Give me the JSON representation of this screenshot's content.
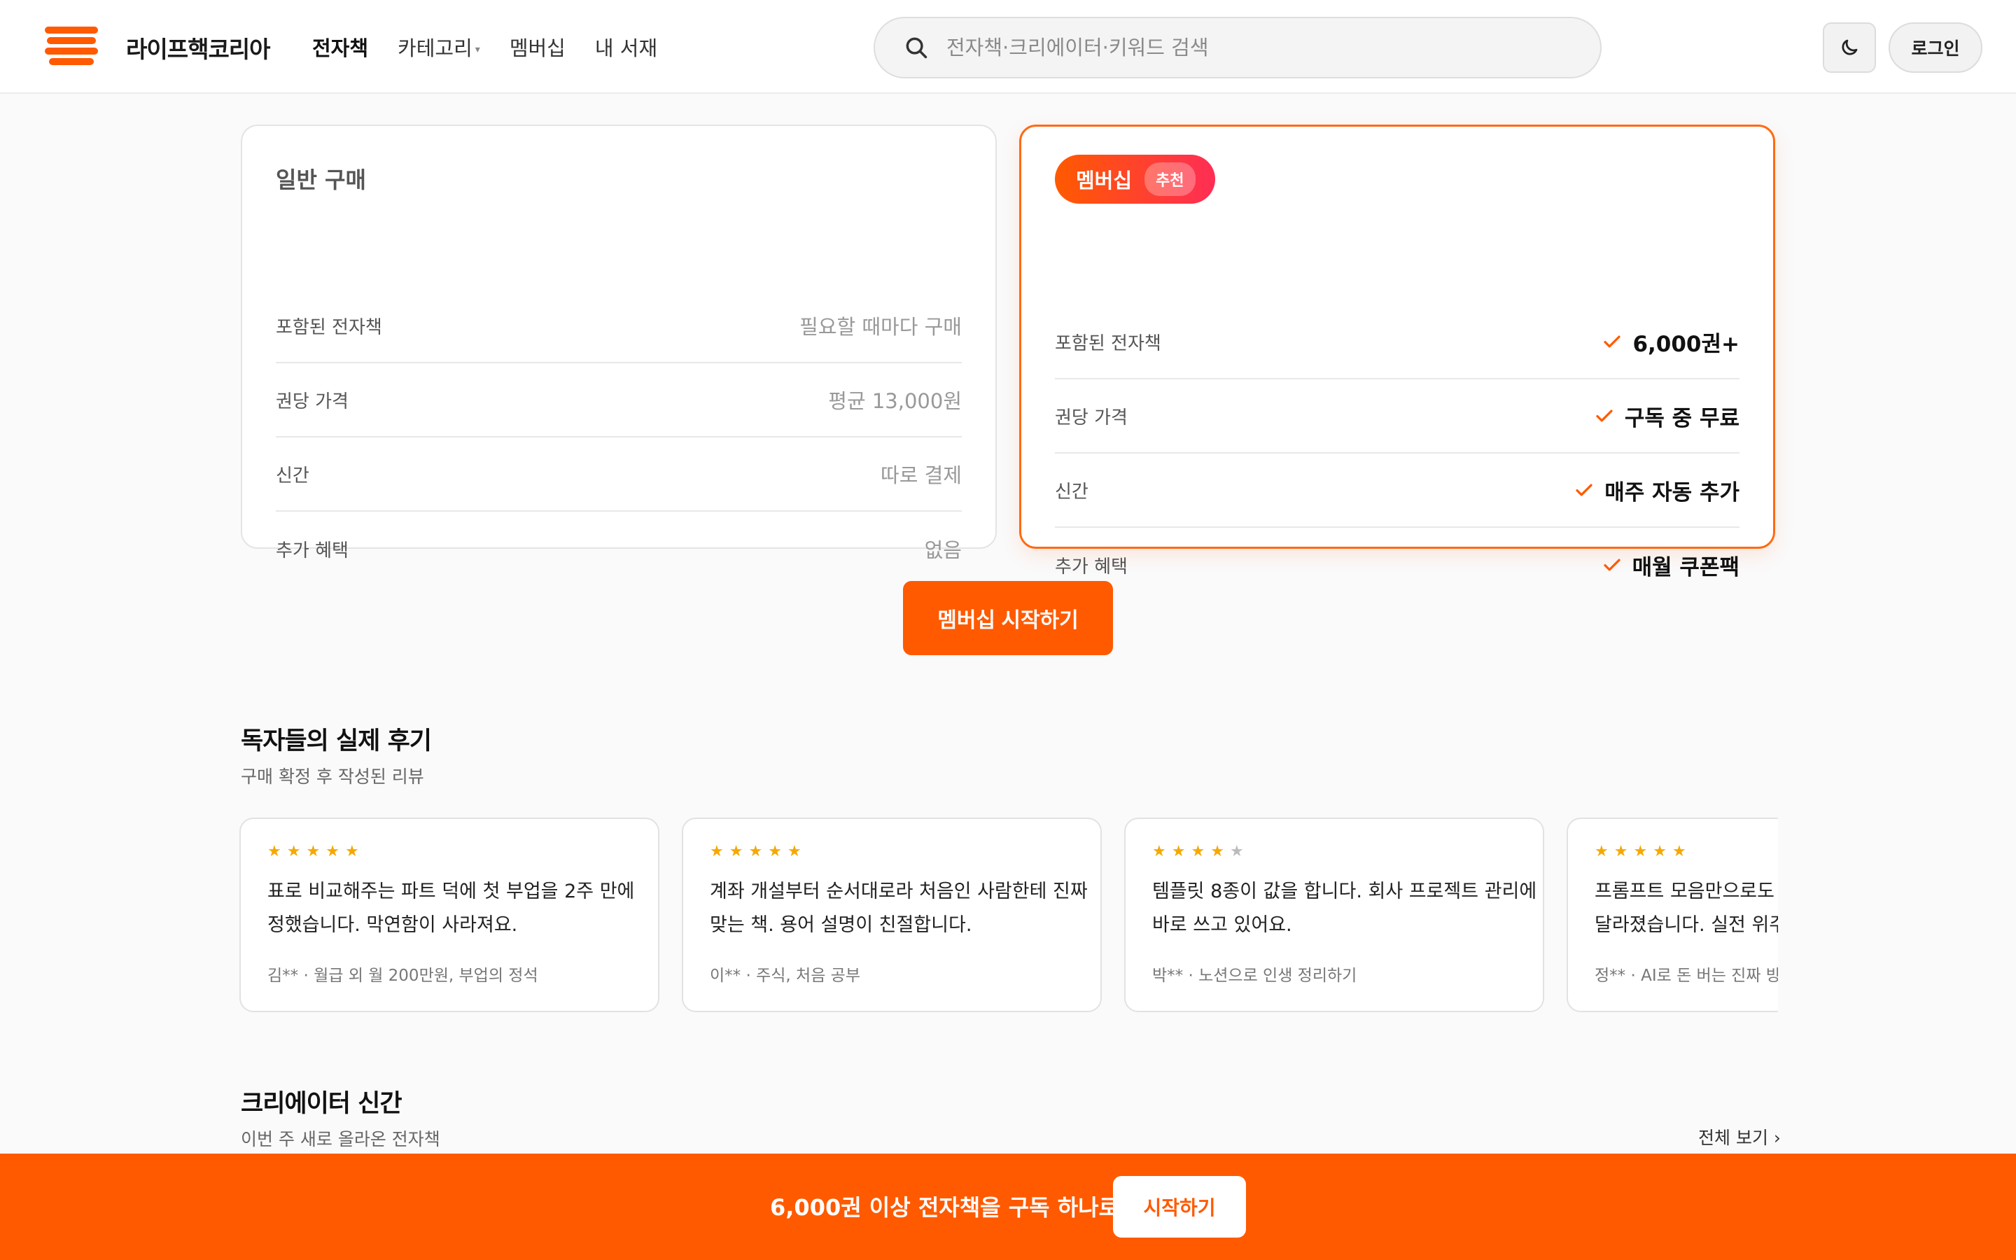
{
  "header": {
    "brand": "라이프핵코리아",
    "nav": [
      {
        "label": "전자책"
      },
      {
        "label": "카테고리"
      },
      {
        "label": "멤버십"
      },
      {
        "label": "내 서재"
      }
    ],
    "search_placeholder": "전자책·크리에이터·키워드 검색",
    "login_label": "로그인"
  },
  "pricing": {
    "basic": {
      "title": "일반 구매",
      "rows": [
        {
          "key": "포함된 전자책",
          "value": "필요할 때마다 구매"
        },
        {
          "key": "권당 가격",
          "value": "평균 13,000원"
        },
        {
          "key": "신간",
          "value": "따로 결제"
        },
        {
          "key": "추가 혜택",
          "value": "없음"
        }
      ]
    },
    "member": {
      "title": "멤버십",
      "tag": "추천",
      "rows": [
        {
          "key": "포함된 전자책",
          "value": "6,000권+"
        },
        {
          "key": "권당 가격",
          "value": "구독 중 무료"
        },
        {
          "key": "신간",
          "value": "매주 자동 추가"
        },
        {
          "key": "추가 혜택",
          "value": "매월 쿠폰팩"
        }
      ]
    },
    "cta_label": "멤버십 시작하기"
  },
  "reviews": {
    "title": "독자들의 실제 후기",
    "subtitle": "구매 확정 후 작성된 리뷰",
    "items": [
      {
        "rating": 5,
        "line1": "표로 비교해주는 파트 덕에 첫 부업을 2주 만에",
        "line2": "정했습니다. 막연함이 사라져요.",
        "meta": "김** · 월급 외 월 200만원, 부업의 정석"
      },
      {
        "rating": 5,
        "line1": "계좌 개설부터 순서대로라 처음인 사람한테 진짜",
        "line2": "맞는 책. 용어 설명이 친절합니다.",
        "meta": "이** · 주식, 처음 공부"
      },
      {
        "rating": 4,
        "line1": "템플릿 8종이 값을 합니다. 회사 프로젝트 관리에",
        "line2": "바로 쓰고 있어요.",
        "meta": "박** · 노션으로 인생 정리하기"
      },
      {
        "rating": 5,
        "line1": "프롬프트 모음만으로도 오",
        "line2": "달라졌습니다. 실전 위주",
        "meta": "정** · AI로 돈 버는 진짜 방법"
      }
    ]
  },
  "new_releases": {
    "title": "크리에이터 신간",
    "subtitle": "이번 주 새로 올라온 전자책",
    "see_all": "전체 보기"
  },
  "bottom_bar": {
    "text": "6,000권 이상 전자책을 구독 하나로",
    "button": "시작하기"
  },
  "colors": {
    "accent": "#ff5a00",
    "star": "#f5a800"
  }
}
